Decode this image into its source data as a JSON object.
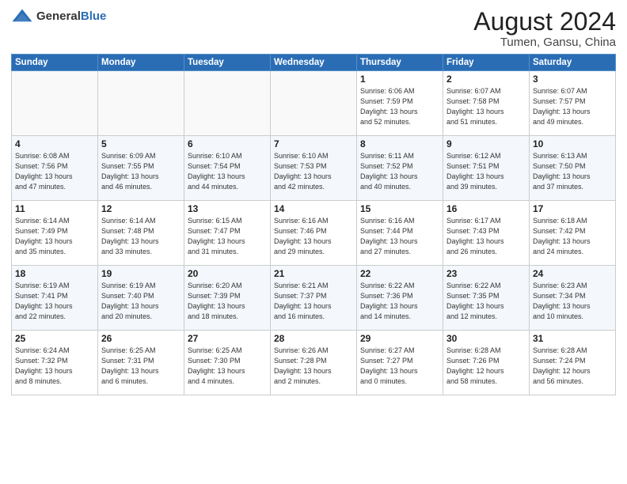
{
  "header": {
    "logo_general": "General",
    "logo_blue": "Blue",
    "title": "August 2024",
    "location": "Tumen, Gansu, China"
  },
  "calendar": {
    "days_of_week": [
      "Sunday",
      "Monday",
      "Tuesday",
      "Wednesday",
      "Thursday",
      "Friday",
      "Saturday"
    ],
    "weeks": [
      [
        {
          "day": "",
          "info": ""
        },
        {
          "day": "",
          "info": ""
        },
        {
          "day": "",
          "info": ""
        },
        {
          "day": "",
          "info": ""
        },
        {
          "day": "1",
          "info": "Sunrise: 6:06 AM\nSunset: 7:59 PM\nDaylight: 13 hours\nand 52 minutes."
        },
        {
          "day": "2",
          "info": "Sunrise: 6:07 AM\nSunset: 7:58 PM\nDaylight: 13 hours\nand 51 minutes."
        },
        {
          "day": "3",
          "info": "Sunrise: 6:07 AM\nSunset: 7:57 PM\nDaylight: 13 hours\nand 49 minutes."
        }
      ],
      [
        {
          "day": "4",
          "info": "Sunrise: 6:08 AM\nSunset: 7:56 PM\nDaylight: 13 hours\nand 47 minutes."
        },
        {
          "day": "5",
          "info": "Sunrise: 6:09 AM\nSunset: 7:55 PM\nDaylight: 13 hours\nand 46 minutes."
        },
        {
          "day": "6",
          "info": "Sunrise: 6:10 AM\nSunset: 7:54 PM\nDaylight: 13 hours\nand 44 minutes."
        },
        {
          "day": "7",
          "info": "Sunrise: 6:10 AM\nSunset: 7:53 PM\nDaylight: 13 hours\nand 42 minutes."
        },
        {
          "day": "8",
          "info": "Sunrise: 6:11 AM\nSunset: 7:52 PM\nDaylight: 13 hours\nand 40 minutes."
        },
        {
          "day": "9",
          "info": "Sunrise: 6:12 AM\nSunset: 7:51 PM\nDaylight: 13 hours\nand 39 minutes."
        },
        {
          "day": "10",
          "info": "Sunrise: 6:13 AM\nSunset: 7:50 PM\nDaylight: 13 hours\nand 37 minutes."
        }
      ],
      [
        {
          "day": "11",
          "info": "Sunrise: 6:14 AM\nSunset: 7:49 PM\nDaylight: 13 hours\nand 35 minutes."
        },
        {
          "day": "12",
          "info": "Sunrise: 6:14 AM\nSunset: 7:48 PM\nDaylight: 13 hours\nand 33 minutes."
        },
        {
          "day": "13",
          "info": "Sunrise: 6:15 AM\nSunset: 7:47 PM\nDaylight: 13 hours\nand 31 minutes."
        },
        {
          "day": "14",
          "info": "Sunrise: 6:16 AM\nSunset: 7:46 PM\nDaylight: 13 hours\nand 29 minutes."
        },
        {
          "day": "15",
          "info": "Sunrise: 6:16 AM\nSunset: 7:44 PM\nDaylight: 13 hours\nand 27 minutes."
        },
        {
          "day": "16",
          "info": "Sunrise: 6:17 AM\nSunset: 7:43 PM\nDaylight: 13 hours\nand 26 minutes."
        },
        {
          "day": "17",
          "info": "Sunrise: 6:18 AM\nSunset: 7:42 PM\nDaylight: 13 hours\nand 24 minutes."
        }
      ],
      [
        {
          "day": "18",
          "info": "Sunrise: 6:19 AM\nSunset: 7:41 PM\nDaylight: 13 hours\nand 22 minutes."
        },
        {
          "day": "19",
          "info": "Sunrise: 6:19 AM\nSunset: 7:40 PM\nDaylight: 13 hours\nand 20 minutes."
        },
        {
          "day": "20",
          "info": "Sunrise: 6:20 AM\nSunset: 7:39 PM\nDaylight: 13 hours\nand 18 minutes."
        },
        {
          "day": "21",
          "info": "Sunrise: 6:21 AM\nSunset: 7:37 PM\nDaylight: 13 hours\nand 16 minutes."
        },
        {
          "day": "22",
          "info": "Sunrise: 6:22 AM\nSunset: 7:36 PM\nDaylight: 13 hours\nand 14 minutes."
        },
        {
          "day": "23",
          "info": "Sunrise: 6:22 AM\nSunset: 7:35 PM\nDaylight: 13 hours\nand 12 minutes."
        },
        {
          "day": "24",
          "info": "Sunrise: 6:23 AM\nSunset: 7:34 PM\nDaylight: 13 hours\nand 10 minutes."
        }
      ],
      [
        {
          "day": "25",
          "info": "Sunrise: 6:24 AM\nSunset: 7:32 PM\nDaylight: 13 hours\nand 8 minutes."
        },
        {
          "day": "26",
          "info": "Sunrise: 6:25 AM\nSunset: 7:31 PM\nDaylight: 13 hours\nand 6 minutes."
        },
        {
          "day": "27",
          "info": "Sunrise: 6:25 AM\nSunset: 7:30 PM\nDaylight: 13 hours\nand 4 minutes."
        },
        {
          "day": "28",
          "info": "Sunrise: 6:26 AM\nSunset: 7:28 PM\nDaylight: 13 hours\nand 2 minutes."
        },
        {
          "day": "29",
          "info": "Sunrise: 6:27 AM\nSunset: 7:27 PM\nDaylight: 13 hours\nand 0 minutes."
        },
        {
          "day": "30",
          "info": "Sunrise: 6:28 AM\nSunset: 7:26 PM\nDaylight: 12 hours\nand 58 minutes."
        },
        {
          "day": "31",
          "info": "Sunrise: 6:28 AM\nSunset: 7:24 PM\nDaylight: 12 hours\nand 56 minutes."
        }
      ]
    ]
  }
}
